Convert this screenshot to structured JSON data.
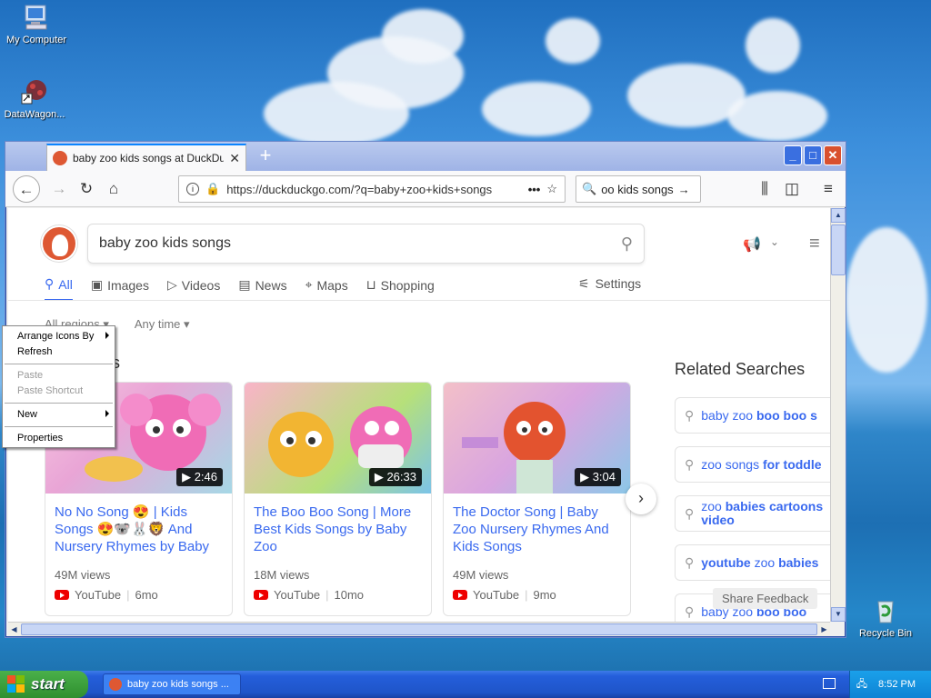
{
  "desktop": {
    "icons": [
      {
        "label": "My Computer"
      },
      {
        "label": "DataWagon..."
      },
      {
        "label": "Recycle Bin"
      }
    ]
  },
  "browser": {
    "tab_title": "baby zoo kids songs at DuckDuckGo",
    "new_tab": "+",
    "url": "https://duckduckgo.com/?q=baby+zoo+kids+songs",
    "search_box": "oo kids songs"
  },
  "ddg": {
    "query": "baby zoo kids songs",
    "tabs": [
      {
        "label": "All",
        "icon": "search-icon",
        "active": true
      },
      {
        "label": "Images",
        "icon": "image-icon",
        "active": false
      },
      {
        "label": "Videos",
        "icon": "play-icon",
        "active": false
      },
      {
        "label": "News",
        "icon": "news-icon",
        "active": false
      },
      {
        "label": "Maps",
        "icon": "map-pin-icon",
        "active": false
      },
      {
        "label": "Shopping",
        "icon": "bag-icon",
        "active": false
      }
    ],
    "settings": "Settings",
    "filters": {
      "region": "All regions",
      "time": "Any time"
    },
    "section_fragment": "s",
    "videos": [
      {
        "duration": "2:46",
        "title": "No No Song 😍 | Kids Songs 😍🐨🐰🦁 And Nursery Rhymes by Baby",
        "views": "49M views",
        "source": "YouTube",
        "age": "6mo"
      },
      {
        "duration": "26:33",
        "title": "The Boo Boo Song | More Best Kids Songs by Baby Zoo",
        "views": "18M views",
        "source": "YouTube",
        "age": "10mo"
      },
      {
        "duration": "3:04",
        "title": "The Doctor Song | Baby Zoo Nursery Rhymes And Kids Songs",
        "views": "49M views",
        "source": "YouTube",
        "age": "9mo"
      }
    ],
    "related_heading": "Related Searches",
    "related": [
      {
        "plain": "baby zoo ",
        "bold": "boo boo s"
      },
      {
        "plain": "zoo songs ",
        "bold": "for toddle"
      },
      {
        "plain": "zoo ",
        "bold": "babies cartoons",
        "line2": "video"
      },
      {
        "plain": "",
        "bold": "youtube",
        "rest": " zoo ",
        "bold2": "babies"
      },
      {
        "plain": "baby zoo ",
        "bold": "boo boo"
      }
    ],
    "feedback": "Share Feedback"
  },
  "context_menu": {
    "items": [
      {
        "label": "Arrange Icons By",
        "submenu": true,
        "disabled": false
      },
      {
        "label": "Refresh",
        "submenu": false,
        "disabled": false
      },
      {
        "sep": true
      },
      {
        "label": "Paste",
        "submenu": false,
        "disabled": true
      },
      {
        "label": "Paste Shortcut",
        "submenu": false,
        "disabled": true
      },
      {
        "sep": true
      },
      {
        "label": "New",
        "submenu": true,
        "disabled": false
      },
      {
        "sep": true
      },
      {
        "label": "Properties",
        "submenu": false,
        "disabled": false
      }
    ]
  },
  "taskbar": {
    "start": "start",
    "task": "baby zoo kids songs ...",
    "clock": "8:52 PM"
  }
}
